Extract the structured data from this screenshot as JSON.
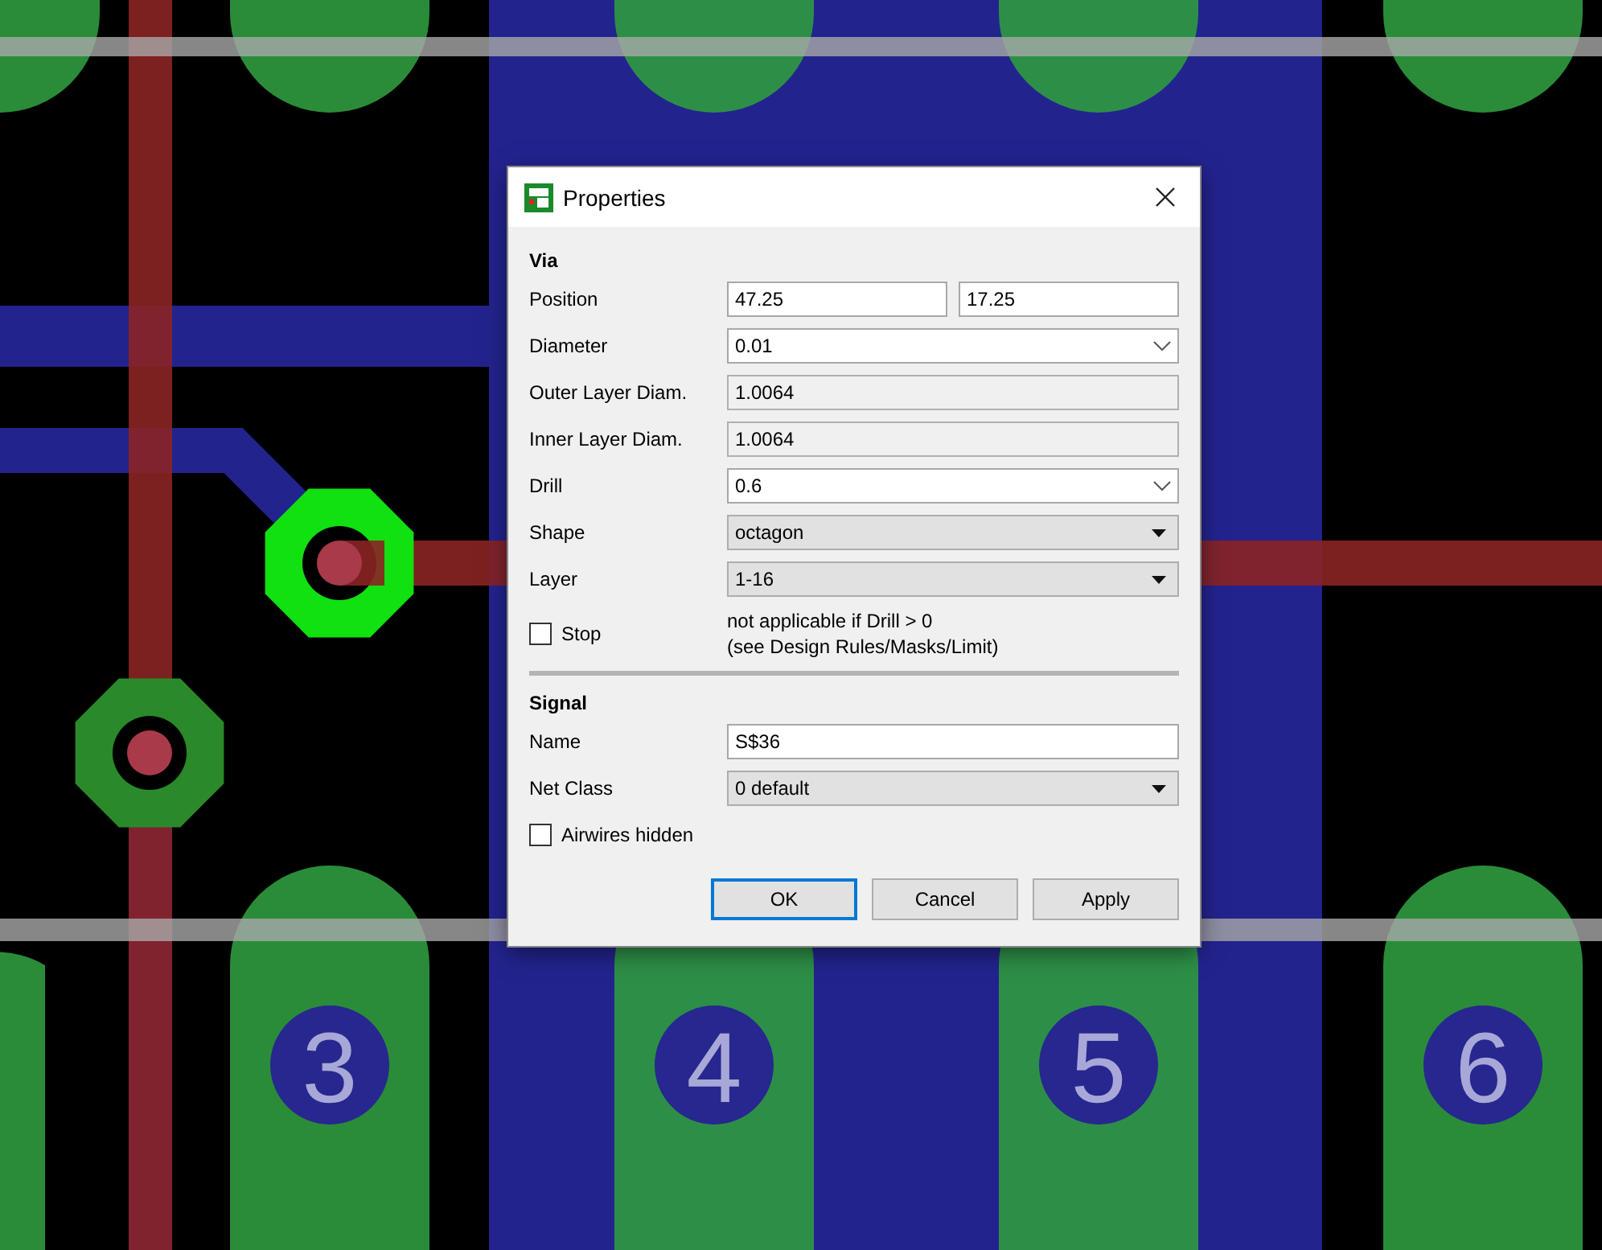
{
  "board": {
    "pad_numbers": [
      "3",
      "4",
      "5",
      "6"
    ]
  },
  "dialog": {
    "title": "Properties",
    "sections": [
      {
        "heading": "Via",
        "rows": [
          {
            "kind": "pair",
            "label": "Position",
            "values": [
              "47.25",
              "17.25"
            ]
          },
          {
            "kind": "combo",
            "label": "Diameter",
            "value": "0.01"
          },
          {
            "kind": "readonly",
            "label": "Outer Layer Diam.",
            "value": "1.0064"
          },
          {
            "kind": "readonly",
            "label": "Inner Layer Diam.",
            "value": "1.0064"
          },
          {
            "kind": "combo",
            "label": "Drill",
            "value": "0.6"
          },
          {
            "kind": "dropdown",
            "label": "Shape",
            "value": "octagon"
          },
          {
            "kind": "dropdown",
            "label": "Layer",
            "value": "1-16"
          },
          {
            "kind": "checkbox",
            "label": "Stop",
            "checked": false,
            "note": [
              "not applicable if Drill > 0",
              "(see Design Rules/Masks/Limit)"
            ]
          }
        ]
      },
      {
        "heading": "Signal",
        "rows": [
          {
            "kind": "text",
            "label": "Name",
            "value": "S$36"
          },
          {
            "kind": "dropdown",
            "label": "Net Class",
            "value": "0 default"
          },
          {
            "kind": "checkbox",
            "label": "Airwires hidden",
            "checked": false
          }
        ]
      }
    ],
    "buttons": [
      {
        "label": "OK",
        "focused": true
      },
      {
        "label": "Cancel",
        "focused": false
      },
      {
        "label": "Apply",
        "focused": false
      }
    ]
  }
}
